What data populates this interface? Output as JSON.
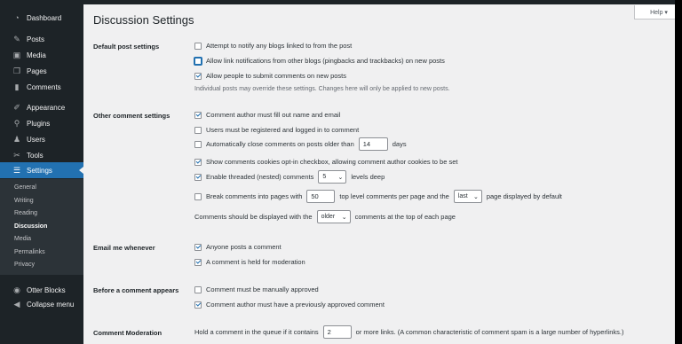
{
  "sidebar": {
    "items": [
      {
        "label": "Dashboard",
        "icon": "dashboard-icon",
        "glyph": "◔"
      },
      {
        "label": "Posts",
        "icon": "pin-icon",
        "glyph": "✎"
      },
      {
        "label": "Media",
        "icon": "media-icon",
        "glyph": "▣"
      },
      {
        "label": "Pages",
        "icon": "pages-icon",
        "glyph": "❐"
      },
      {
        "label": "Comments",
        "icon": "comments-icon",
        "glyph": "▮"
      },
      {
        "label": "Appearance",
        "icon": "appearance-icon",
        "glyph": "✐"
      },
      {
        "label": "Plugins",
        "icon": "plugins-icon",
        "glyph": "⚲"
      },
      {
        "label": "Users",
        "icon": "users-icon",
        "glyph": "♟"
      },
      {
        "label": "Tools",
        "icon": "tools-icon",
        "glyph": "✂"
      },
      {
        "label": "Settings",
        "icon": "settings-icon",
        "glyph": "☰"
      }
    ],
    "submenu": [
      "General",
      "Writing",
      "Reading",
      "Discussion",
      "Media",
      "Permalinks",
      "Privacy"
    ],
    "otter": {
      "label": "Otter Blocks",
      "glyph": "◉"
    },
    "collapse": {
      "label": "Collapse menu",
      "glyph": "◀"
    }
  },
  "header": {
    "title": "Discussion Settings",
    "help": "Help ▾"
  },
  "sections": {
    "default_post": {
      "title": "Default post settings",
      "opt1": "Attempt to notify any blogs linked to from the post",
      "opt2": "Allow link notifications from other blogs (pingbacks and trackbacks) on new posts",
      "opt3": "Allow people to submit comments on new posts",
      "note": "Individual posts may override these settings. Changes here will only be applied to new posts."
    },
    "other_comment": {
      "title": "Other comment settings",
      "opt1": "Comment author must fill out name and email",
      "opt2": "Users must be registered and logged in to comment",
      "opt3_pre": "Automatically close comments on posts older than",
      "opt3_value": "14",
      "opt3_post": "days",
      "opt4": "Show comments cookies opt-in checkbox, allowing comment author cookies to be set",
      "opt5_pre": "Enable threaded (nested) comments",
      "opt5_value": "5",
      "opt5_post": "levels deep",
      "opt6_pre": "Break comments into pages with",
      "opt6_value": "50",
      "opt6_mid": "top level comments per page and the",
      "opt6_select": "last",
      "opt6_post": "page displayed by default",
      "order_pre": "Comments should be displayed with the",
      "order_select": "older",
      "order_post": "comments at the top of each page"
    },
    "email": {
      "title": "Email me whenever",
      "opt1": "Anyone posts a comment",
      "opt2": "A comment is held for moderation"
    },
    "before": {
      "title": "Before a comment appears",
      "opt1": "Comment must be manually approved",
      "opt2": "Comment author must have a previously approved comment"
    },
    "moderation": {
      "title": "Comment Moderation",
      "pre": "Hold a comment in the queue if it contains",
      "value": "2",
      "post": "or more links. (A common characteristic of comment spam is a large number of hyperlinks.)"
    }
  }
}
